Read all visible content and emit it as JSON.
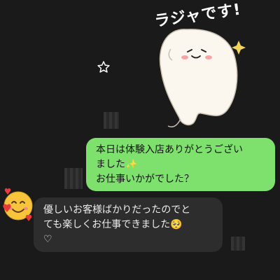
{
  "sticker": {
    "caption": "ラジャです!"
  },
  "messages": {
    "outgoing": {
      "line1": "本日は体験入店ありがとうござい",
      "line2": "ました✨",
      "line3": "お仕事いかがでした？"
    },
    "incoming": {
      "line1": "優しいお客様ばかりだったのでと",
      "line2": "ても楽しくお仕事できました🥺",
      "line3": "♡"
    }
  },
  "icons": {
    "star": "star-icon",
    "avatar": "smiling-face-with-hearts-emoji"
  },
  "colors": {
    "background": "#1a1a1a",
    "outgoing_bubble": "#7ee06d",
    "incoming_bubble": "#2d2d2d"
  }
}
